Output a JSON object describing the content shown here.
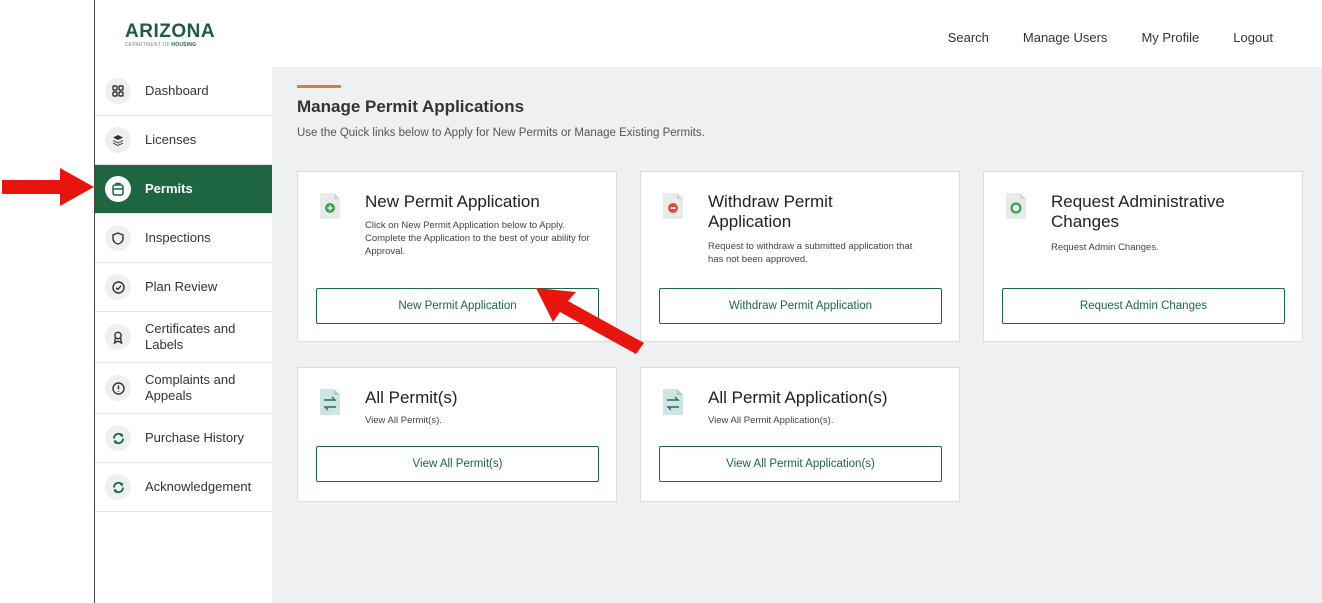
{
  "header": {
    "logo_main": "ARIZONA",
    "logo_sub_prefix": "DEPARTMENT OF ",
    "logo_sub_bold": "HOUSING",
    "nav": [
      "Search",
      "Manage Users",
      "My Profile",
      "Logout"
    ]
  },
  "sidebar": {
    "items": [
      {
        "label": "Dashboard",
        "icon": "grid-icon"
      },
      {
        "label": "Licenses",
        "icon": "layers-icon"
      },
      {
        "label": "Permits",
        "icon": "clipboard-icon",
        "active": true
      },
      {
        "label": "Inspections",
        "icon": "shield-icon"
      },
      {
        "label": "Plan Review",
        "icon": "check-circle-icon"
      },
      {
        "label": "Certificates and Labels",
        "icon": "award-icon"
      },
      {
        "label": "Complaints and Appeals",
        "icon": "alert-circle-icon"
      },
      {
        "label": "Purchase History",
        "icon": "refresh-icon"
      },
      {
        "label": "Acknowledgement",
        "icon": "refresh-icon"
      }
    ]
  },
  "main": {
    "title": "Manage Permit Applications",
    "subtitle": "Use the Quick links below to Apply for New Permits or Manage Existing Permits.",
    "cards": [
      {
        "title": "New Permit Application",
        "desc": "Click on New Permit Application below to Apply. Complete the Application to the best of your ability for Approval.",
        "button": "New Permit Application",
        "icon": "document-plus-icon"
      },
      {
        "title": "Withdraw Permit Application",
        "desc": "Request to withdraw a submitted application that has not been approved.",
        "button": "Withdraw Permit Application",
        "icon": "document-minus-icon"
      },
      {
        "title": "Request Administrative Changes",
        "desc": "Request Admin Changes.",
        "button": "Request Admin Changes",
        "icon": "document-circle-icon"
      },
      {
        "title": "All Permit(s)",
        "desc": "View All Permit(s).",
        "button": "View All Permit(s)",
        "icon": "document-swap-icon"
      },
      {
        "title": "All Permit Application(s)",
        "desc": "View All Permit Application(s).",
        "button": "View All Permit Application(s)",
        "icon": "document-swap-icon"
      }
    ]
  },
  "colors": {
    "brand_green": "#1e6641",
    "accent_orange": "#e07a3c",
    "annotation_red": "#e8150f"
  }
}
